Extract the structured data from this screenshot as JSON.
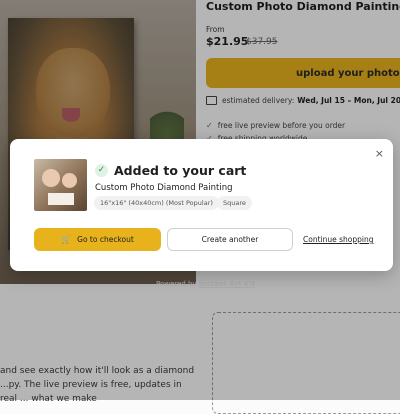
{
  "product": {
    "title": "Custom Photo Diamond Painting",
    "from_label": "From",
    "price": "$21.95",
    "price_old": "$37.95",
    "upload_label": "upload your photo",
    "upload_icon_glyph": "@",
    "delivery_label": "estimated delivery:",
    "delivery_dates": "Wed, Jul 15 – Mon, Jul 20",
    "benefits": [
      "free live preview before you order",
      "free shipping worldwide"
    ],
    "powered_by": "Powered by",
    "powered_brand": "Instant Art Kit",
    "description": "and see exactly how it'll look as a diamond ...py. The live preview is free, updates in real ... what we make"
  },
  "modal": {
    "close_glyph": "×",
    "success_glyph": "✓",
    "title": "Added to your cart",
    "item_name": "Custom Photo Diamond Painting",
    "chips": [
      "16\"x16\" (40x40cm) (Most Popular)",
      "Square"
    ],
    "checkout_label": "Go to checkout",
    "cart_glyph": "🛒",
    "create_label": "Create another",
    "continue_label": "Continue shopping"
  },
  "colors": {
    "accent": "#e7b21c",
    "success": "#2f8f4e",
    "overlay": "rgba(0,0,0,0.28)"
  },
  "icons": [
    "close-icon",
    "check-circle-icon",
    "cart-icon",
    "truck-icon",
    "check-icon"
  ]
}
